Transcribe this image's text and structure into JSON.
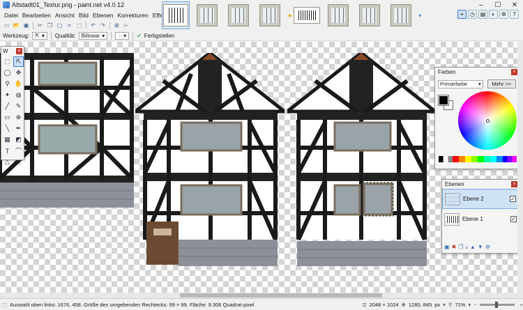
{
  "window": {
    "title": "Altstadt01_Textur.png - paint.net v4.0.12",
    "minimize": "–",
    "maximize": "☐",
    "close": "✕"
  },
  "menu": [
    "Datei",
    "Bearbeiten",
    "Ansicht",
    "Bild",
    "Ebenen",
    "Korrekturen",
    "Effekte"
  ],
  "options": {
    "tool_label": "Werkzeug:",
    "quality_label": "Qualität:",
    "quality_value": "Bilinear",
    "finish_label": "Fertigstellen"
  },
  "tools_palette": {
    "title": "W"
  },
  "colors_panel": {
    "title": "Farben",
    "mode": "Primärfarbe",
    "more_button": "Mehr >>"
  },
  "layers_panel": {
    "title": "Ebenen",
    "layers": [
      {
        "name": "Ebene 2",
        "visible": true,
        "selected": true
      },
      {
        "name": "Ebene 1",
        "visible": true,
        "selected": false
      }
    ]
  },
  "status": {
    "selection_text": "Auswahl oben links: 1676, 458. Größe des umgebenden Rechtecks: 99 × 99. Fläche: 9.306 Quadrat-pixel",
    "image_size": "2048 × 1024",
    "cursor_pos": "1280, 845",
    "unit": "px",
    "zoom": "71%"
  },
  "colors": {
    "accent": "#3d7bd0",
    "primary": "#000000",
    "secondary": "#ffffff"
  }
}
